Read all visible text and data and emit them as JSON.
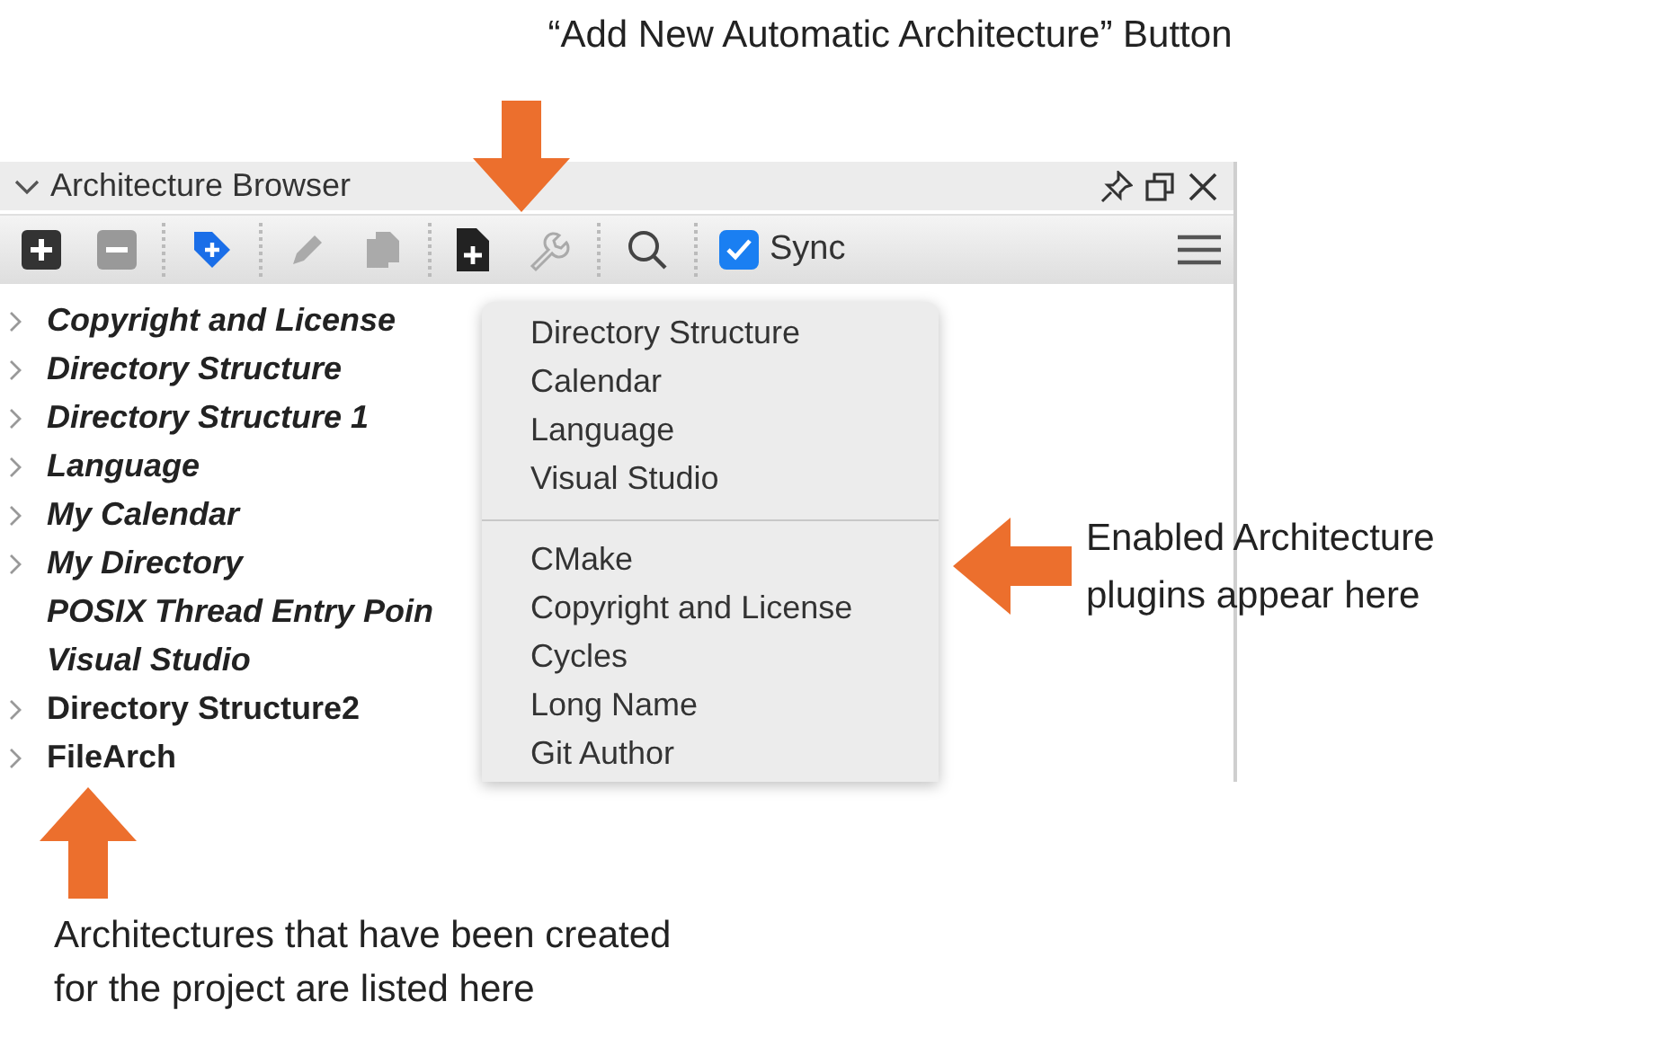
{
  "callouts": {
    "top": "“Add New Automatic Architecture” Button",
    "right": "Enabled Architecture plugins appear here",
    "bottom": "Architectures that have been created for the project are listed here"
  },
  "panel": {
    "title": "Architecture Browser",
    "toolbar": [
      {
        "kind": "add",
        "disabled": false
      },
      {
        "kind": "remove",
        "disabled": true
      },
      {
        "kind": "separator"
      },
      {
        "kind": "tag",
        "disabled": false
      },
      {
        "kind": "separator"
      },
      {
        "kind": "edit",
        "disabled": true
      },
      {
        "kind": "copy",
        "disabled": true
      },
      {
        "kind": "separator"
      },
      {
        "kind": "new-file",
        "disabled": false
      },
      {
        "kind": "wrench",
        "disabled": true
      },
      {
        "kind": "separator"
      },
      {
        "kind": "search",
        "disabled": false
      },
      {
        "kind": "separator"
      }
    ],
    "sync": {
      "label": "Sync",
      "checked": true
    },
    "items": [
      {
        "label": "Copyright and License",
        "expandable": true,
        "italic": true
      },
      {
        "label": "Directory Structure",
        "expandable": true,
        "italic": true
      },
      {
        "label": "Directory Structure 1",
        "expandable": true,
        "italic": true
      },
      {
        "label": "Language",
        "expandable": true,
        "italic": true
      },
      {
        "label": "My Calendar",
        "expandable": true,
        "italic": true
      },
      {
        "label": "My Directory",
        "expandable": true,
        "italic": true
      },
      {
        "label": "POSIX Thread Entry Poin",
        "expandable": false,
        "italic": true
      },
      {
        "label": "Visual Studio",
        "expandable": false,
        "italic": true
      },
      {
        "label": "Directory Structure2",
        "expandable": true,
        "italic": false
      },
      {
        "label": "FileArch",
        "expandable": true,
        "italic": false
      }
    ],
    "menu": {
      "sections": [
        [
          "Directory Structure",
          "Calendar",
          "Language",
          "Visual Studio"
        ],
        [
          "CMake",
          "Copyright and License",
          "Cycles",
          "Long Name",
          "Git Author"
        ]
      ]
    }
  }
}
